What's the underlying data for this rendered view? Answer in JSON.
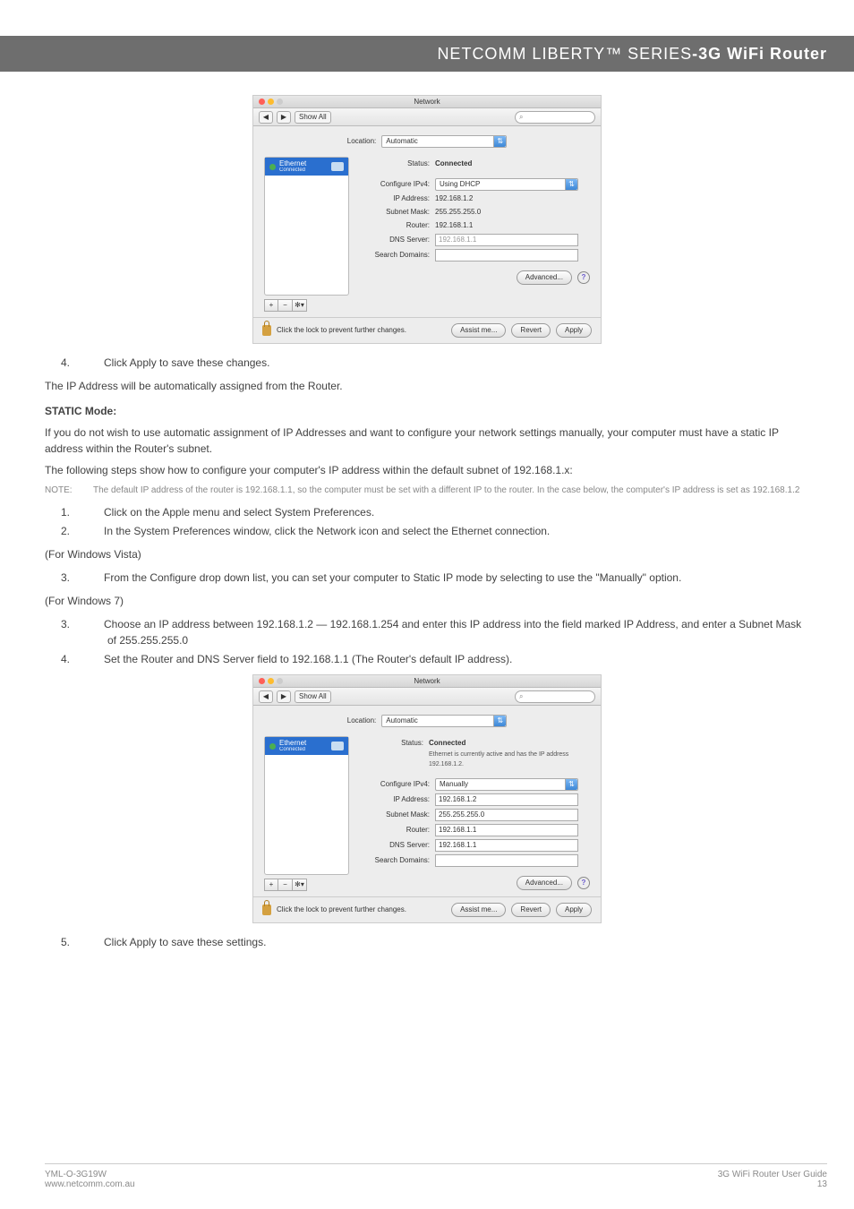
{
  "header": {
    "series": "NETCOMM LIBERTY™ SERIES",
    "dash": " - ",
    "product": "3G WiFi Router"
  },
  "screenshot1": {
    "window_title": "Network",
    "nav_back": "◀",
    "nav_fwd": "▶",
    "show_all": "Show All",
    "search_placeholder": "Q",
    "location_label": "Location:",
    "location_value": "Automatic",
    "sidebar": {
      "name": "Ethernet",
      "status": "Connected"
    },
    "status_label": "Status:",
    "status_value": "Connected",
    "rows": {
      "config_label": "Configure IPv4:",
      "config_value": "Using DHCP",
      "ip_label": "IP Address:",
      "ip_value": "192.168.1.2",
      "subnet_label": "Subnet Mask:",
      "subnet_value": "255.255.255.0",
      "router_label": "Router:",
      "router_value": "192.168.1.1",
      "dns_label": "DNS Server:",
      "dns_value": "192.168.1.1",
      "search_label": "Search Domains:",
      "search_value": ""
    },
    "list_btns": {
      "plus": "+",
      "minus": "−",
      "gear": "✻▾"
    },
    "advanced": "Advanced...",
    "help": "?",
    "lock_text": "Click the lock to prevent further changes.",
    "assist": "Assist me...",
    "revert": "Revert",
    "apply": "Apply"
  },
  "screenshot2": {
    "window_title": "Network",
    "nav_back": "◀",
    "nav_fwd": "▶",
    "show_all": "Show All",
    "search_placeholder": "Q",
    "location_label": "Location:",
    "location_value": "Automatic",
    "sidebar": {
      "name": "Ethernet",
      "status": "Connected"
    },
    "status_label": "Status:",
    "status_value": "Connected",
    "status_extra": "Ethernet is currently active and has the IP address 192.168.1.2.",
    "rows": {
      "config_label": "Configure IPv4:",
      "config_value": "Manually",
      "ip_label": "IP Address:",
      "ip_value": "192.168.1.2",
      "subnet_label": "Subnet Mask:",
      "subnet_value": "255.255.255.0",
      "router_label": "Router:",
      "router_value": "192.168.1.1",
      "dns_label": "DNS Server:",
      "dns_value": "192.168.1.1",
      "search_label": "Search Domains:",
      "search_value": ""
    },
    "list_btns": {
      "plus": "+",
      "minus": "−",
      "gear": "✻▾"
    },
    "advanced": "Advanced...",
    "help": "?",
    "lock_text": "Click the lock to prevent further changes.",
    "assist": "Assist me...",
    "revert": "Revert",
    "apply": "Apply"
  },
  "text": {
    "step4a": "4.",
    "step4a_txt": "Click Apply to save these changes.",
    "p1": "The IP Address will be automatically assigned from the Router.",
    "static_title": "STATIC Mode:",
    "p2": "If you do not wish to use automatic assignment of IP Addresses and want to configure your network settings manually, your computer must have a static IP address within the Router's subnet.",
    "p3": "The following steps show how to configure your computer's IP address within the default subnet of 192.168.1.x:",
    "note_tag": "NOTE:",
    "note_txt": "The default IP address of the router is 192.168.1.1, so the computer must be set with a different IP to the router. In the case below, the computer's IP address is set as 192.168.1.2",
    "s1n": "1.",
    "s1": "Click on the Apple menu and select System Preferences.",
    "s2n": "2.",
    "s2": "In the System Preferences window, click the Network icon and select the Ethernet connection.",
    "vista": "(For Windows Vista)",
    "s3n": "3.",
    "s3": "From the Configure drop down list, you can set your computer to Static IP mode by selecting to use the \"Manually\" option.",
    "win7": "(For Windows 7)",
    "s3bn": "3.",
    "s3b": "Choose an IP address between 192.168.1.2 — 192.168.1.254 and enter this IP address into the field marked IP Address, and enter a Subnet Mask of 255.255.255.0",
    "s4bn": "4.",
    "s4b": "Set the Router and DNS Server field to 192.168.1.1 (The Router's default IP address).",
    "s5n": "5.",
    "s5": "Click Apply to save these settings."
  },
  "footer": {
    "left1": "YML-O-3G19W",
    "left2": "www.netcomm.com.au",
    "right1": "3G WiFi Router User Guide",
    "right2": "13"
  }
}
